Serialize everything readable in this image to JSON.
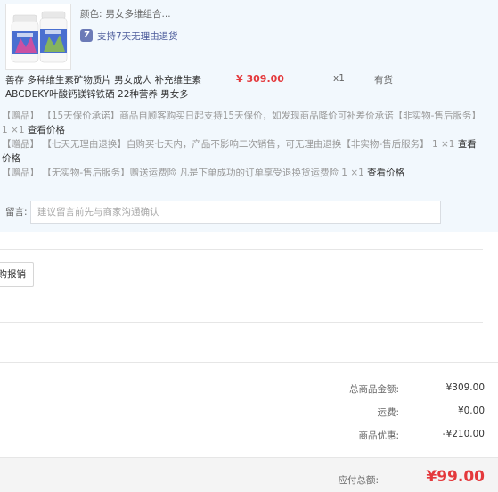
{
  "item": {
    "color_label": "颜色:",
    "color_value": "男女多维组合...",
    "return_badge": "7",
    "return_text": "支持7天无理由退货",
    "name": "善存 多种维生素矿物质片 男女成人 补充维生素ABCDEKY叶酸钙镁锌铁硒 22种营养 男女多",
    "price": "¥ 309.00",
    "qty": "x1",
    "stock": "有货"
  },
  "services": [
    {
      "tag": "【赠品】",
      "text": "【15天保价承诺】商品自顾客购买日起支持15天保价，如发现商品降价可补差价承诺【非实物-售后服务】 1 ×1",
      "link": "查看价格"
    },
    {
      "tag": "【赠品】",
      "text": "【七天无理由退换】自购买七天内，产品不影响二次销售，可无理由退换【非实物-售后服务】 1 ×1",
      "link": "查看价格"
    },
    {
      "tag": "【赠品】",
      "text": "【无实物-售后服务】赠送运费险 凡是下单成功的订单享受退换货运费险 1 ×1",
      "link": "查看价格"
    }
  ],
  "message": {
    "label": "留言:",
    "placeholder": "建议留言前先与商家沟通确认"
  },
  "invoice": {
    "button": "购报销"
  },
  "summary": [
    {
      "label": "总商品金额:",
      "value": "¥309.00"
    },
    {
      "label": "运费:",
      "value": "¥0.00"
    },
    {
      "label": "商品优惠:",
      "value": "-¥210.00"
    }
  ],
  "total": {
    "label": "应付总额:",
    "value": "¥99.00"
  },
  "colors": {
    "price_red": "#e4393c",
    "panel_bg": "#f2f8fd",
    "badge": "#6b7ab7"
  }
}
